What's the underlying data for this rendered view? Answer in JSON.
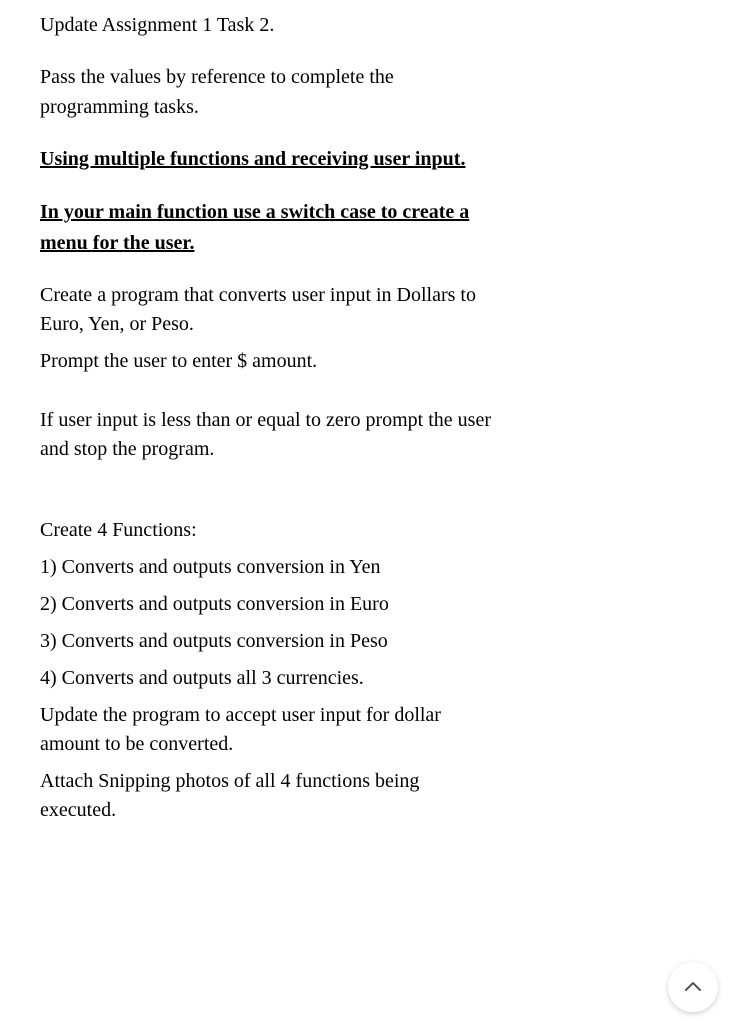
{
  "doc": {
    "title": "Update Assignment 1 Task 2.",
    "intro": "Pass the values by reference to complete the programming tasks.",
    "heading1": "Using multiple functions and receiving user input.",
    "heading2": "In your main function use a switch case to create a menu for the user.",
    "para1": "Create a program that converts user input in Dollars to Euro, Yen, or Peso.",
    "para2": "Prompt the user to enter $ amount.",
    "para3": "If user input is less than or equal to zero prompt the user and stop the program.",
    "functionsHeader": "Create 4 Functions:",
    "func1": "1) Converts and outputs conversion in Yen",
    "func2": "2) Converts and outputs conversion in Euro",
    "func3": "3) Converts and outputs conversion in Peso",
    "func4": "4) Converts and outputs all 3 currencies.",
    "para4": "Update the program to accept user input for dollar amount to be converted.",
    "para5": "Attach Snipping photos of all 4 functions being executed."
  }
}
